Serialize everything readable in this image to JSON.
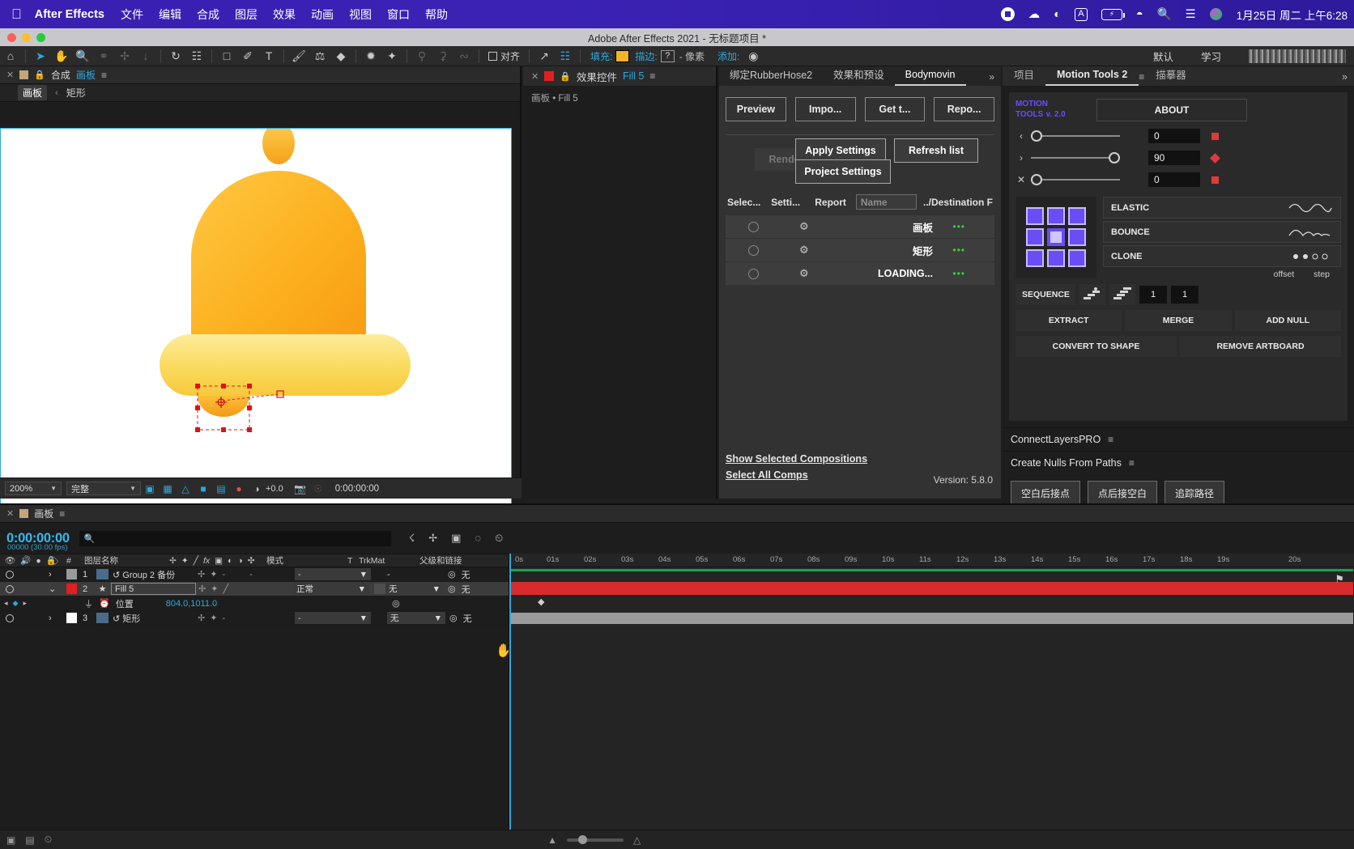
{
  "macbar": {
    "apple_icon": "apple-icon",
    "app_name": "After Effects",
    "menus": [
      "文件",
      "编辑",
      "合成",
      "图层",
      "效果",
      "动画",
      "视图",
      "窗口",
      "帮助"
    ],
    "status_icons": [
      "record-icon",
      "weather-icon",
      "crescent-icon",
      "keyboard-input-icon",
      "battery-icon",
      "wifi-icon",
      "search-icon",
      "control-center-icon",
      "siri-icon"
    ],
    "input_source": "A",
    "battery_glyph": "⚡",
    "clock": "1月25日 周二 上午6:28"
  },
  "titlebar": {
    "title": "Adobe After Effects 2021 - 无标题项目 *"
  },
  "toolbar": {
    "tools": [
      "home-icon",
      "selection-tool-icon",
      "hand-tool-icon",
      "zoom-tool-icon",
      "rotation-tool-icon",
      "unified-camera-tool-icon",
      "pan-behind-tool-icon",
      "rotate-alt-icon",
      "mask-tool-icon",
      "shape-tool-icon",
      "pen-tool-icon",
      "type-tool-icon",
      "brush-tool-icon",
      "clone-stamp-tool-icon",
      "eraser-tool-icon",
      "roto-brush-tool-icon",
      "puppet-pin-tool-icon",
      "puppet-overlap-icon",
      "puppet-starch-icon",
      "puppet-bend-icon"
    ],
    "align_label": "对齐",
    "fill_label": "填充:",
    "fill_color": "#f0b429",
    "stroke_label": "描边:",
    "stroke_value": "?",
    "pixel_label": "- 像素",
    "add_label": "添加:",
    "workspace_default": "默认",
    "workspace_learn": "学习"
  },
  "comp_panel": {
    "tab_label": "合成",
    "tab_name": "画板",
    "breadcrumb_active": "画板",
    "breadcrumb_sep": "‹",
    "breadcrumb_child": "矩形",
    "zoom": "200%",
    "resolution": "完整",
    "exposure": "+0.0",
    "timecode": "0:00:00:00",
    "bottom_icons": [
      "toggle-mask-icon",
      "toggle-transparency-grid-icon",
      "toggle-guides-icon",
      "region-of-interest-icon",
      "toggle-view-layout-icon",
      "channel-icon",
      "exposure-reset-icon",
      "snapshot-icon",
      "show-snapshot-icon"
    ]
  },
  "fx_panel": {
    "tab_label": "效果控件",
    "tab_target": "Fill 5",
    "subtitle": "画板 • Fill 5"
  },
  "bodymovin": {
    "tabs": [
      "绑定RubberHose2",
      "效果和预设",
      "Bodymovin"
    ],
    "active_tab": "Bodymovin",
    "buttons": [
      "Preview",
      "Impo...",
      "Get t...",
      "Repo..."
    ],
    "render_label": "Render",
    "apply_settings": "Apply Settings",
    "project_settings": "Project Settings",
    "refresh_list": "Refresh list",
    "columns": {
      "select": "Selec...",
      "settings": "Setti...",
      "report": "Report",
      "name_placeholder": "Name",
      "destination": "../Destination F"
    },
    "items": [
      {
        "name": "画板",
        "dots": "•••"
      },
      {
        "name": "矩形",
        "dots": "•••"
      },
      {
        "name": "LOADING...",
        "dots": "•••"
      }
    ],
    "link_selected": "Show Selected Compositions",
    "link_all": "Select All Comps",
    "version": "Version: 5.8.0"
  },
  "right_panel": {
    "tabs": [
      "项目",
      "Motion Tools 2",
      "描摹器"
    ],
    "active_tab": "Motion Tools 2",
    "motion_tools": {
      "logo_line1": "MOTION",
      "logo_line2": "TOOLS",
      "logo_version": "v. 2.0",
      "about": "ABOUT",
      "sliders": [
        {
          "arrow": "‹",
          "value": "0",
          "knob_pct": 0
        },
        {
          "arrow": "›",
          "value": "90",
          "knob_pct": 100
        },
        {
          "arrow": "✕",
          "value": "0",
          "knob_pct": 0
        }
      ],
      "elastic": "ELASTIC",
      "bounce": "BOUNCE",
      "clone": "CLONE",
      "offset_label": "offset",
      "step_label": "step",
      "sequence": "SEQUENCE",
      "offset_value": "1",
      "step_value": "1",
      "extract": "EXTRACT",
      "merge": "MERGE",
      "add_null": "ADD NULL",
      "convert_to_shape": "CONVERT TO SHAPE",
      "remove_artboard": "REMOVE ARTBOARD"
    },
    "connect_layers": "ConnectLayersPRO",
    "create_nulls": "Create Nulls From Paths",
    "nulls_buttons": [
      "空白后接点",
      "点后接空白",
      "追踪路径"
    ]
  },
  "timeline": {
    "tab_name": "画板",
    "timecode": "0:00:00:00",
    "frame_info": "00000 (30.00 fps)",
    "search_placeholder": "",
    "columns": [
      "#",
      "图层名称",
      "模式",
      "T",
      "TrkMat",
      "父级和链接"
    ],
    "switch_icons": [
      "anchor-icon",
      "transform-icon",
      "quality-icon",
      "fx-icon",
      "frame-blend-icon",
      "motion-blur-icon",
      "adjustment-icon",
      "3d-icon"
    ],
    "layers": [
      {
        "index": "1",
        "name": "Group 2 备份",
        "swatch": "#9a9a9a",
        "mode": "-",
        "trkmat": "-",
        "parent": "无",
        "bar_color": "#16a34a",
        "selected": false,
        "expanded": false
      },
      {
        "index": "2",
        "name": "Fill 5",
        "swatch": "#e02020",
        "mode": "正常",
        "trkmat": "无",
        "parent": "无",
        "bar_color": "#d92b2b",
        "selected": true,
        "expanded": true,
        "property": {
          "name": "位置",
          "value": "804.0,1011.0"
        }
      },
      {
        "index": "3",
        "name": "矩形",
        "swatch": "#ffffff",
        "mode": "-",
        "trkmat": "无",
        "parent": "无",
        "bar_color": "#9a9a9a",
        "selected": false,
        "expanded": false
      }
    ],
    "ruler_ticks": [
      "0s",
      "01s",
      "02s",
      "03s",
      "04s",
      "05s",
      "06s",
      "07s",
      "08s",
      "09s",
      "10s",
      "11s",
      "12s",
      "13s",
      "14s",
      "15s",
      "16s",
      "17s",
      "18s",
      "19s",
      "20s"
    ]
  }
}
